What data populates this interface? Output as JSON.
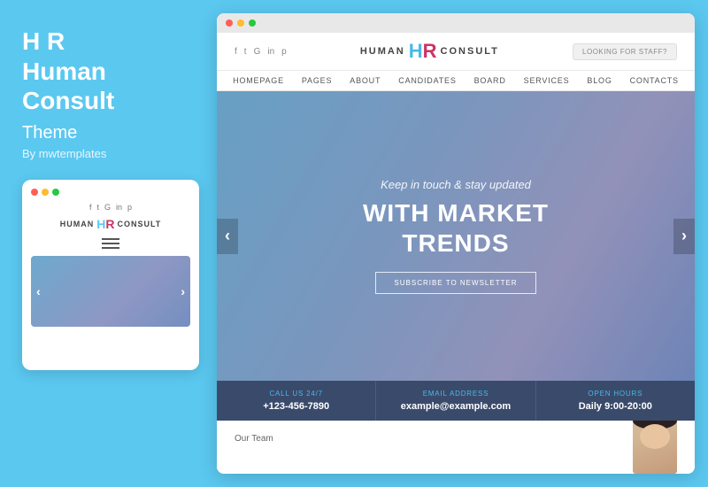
{
  "left": {
    "title": "H R\nHuman\nConsult",
    "subtitle": "Theme",
    "by": "By mwtemplates"
  },
  "mobile": {
    "social_icons": [
      "f",
      "t",
      "G",
      "in",
      "p"
    ],
    "logo_human": "HUMAN",
    "logo_hr": "HR",
    "logo_consult": "CONSULT",
    "hero_arrow_left": "‹",
    "hero_arrow_right": "›"
  },
  "desktop": {
    "titlebar_dots": [
      "●",
      "●",
      "●"
    ],
    "social_icons": [
      "f",
      "t",
      "G",
      "in",
      "p"
    ],
    "logo_human": "HUMAN",
    "logo_hr": "HR",
    "logo_consult": "CONSULT",
    "nav_button": "LOOKING FOR STAFF?",
    "menu_items": [
      "HOMEPAGE",
      "PAGES",
      "ABOUT",
      "CANDIDATES",
      "BOARD",
      "SERVICES",
      "BLOG",
      "CONTACTS"
    ],
    "hero_subtitle": "Keep in touch & stay updated",
    "hero_title": "WITH MARKET\nTRENDS",
    "hero_btn": "SUBSCRIBE TO NEWSLETTER",
    "hero_arrow_left": "‹",
    "hero_arrow_right": "›",
    "info": [
      {
        "label": "CALL US 24/7",
        "value": "+123-456-7890"
      },
      {
        "label": "EMAIL ADDRESS",
        "value": "example@example.com"
      },
      {
        "label": "OPEN HOURS",
        "value": "Daily 9:00-20:00"
      }
    ]
  }
}
